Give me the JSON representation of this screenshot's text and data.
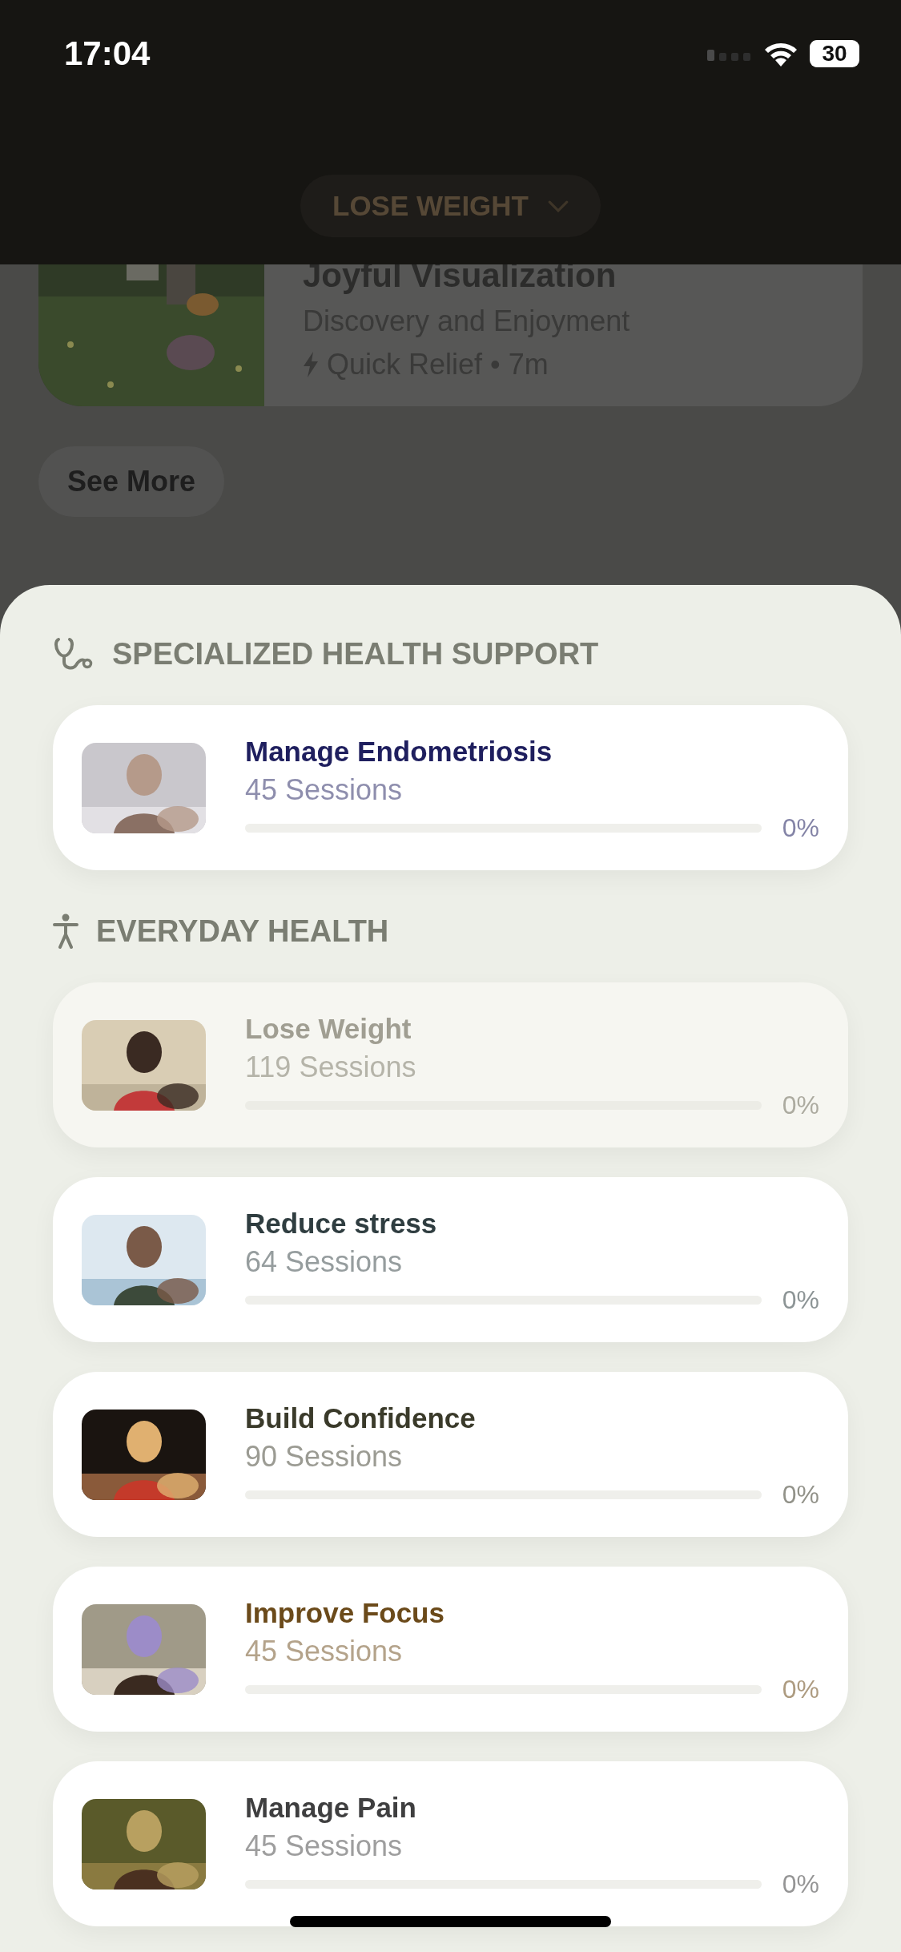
{
  "status_bar": {
    "time": "17:04",
    "battery": "30"
  },
  "header": {
    "goal_button": "LOSE WEIGHT"
  },
  "background": {
    "featured": {
      "title": "Joyful Visualization",
      "subtitle": "Discovery and Enjoyment",
      "meta": "Quick Relief • 7m"
    },
    "see_more": "See More"
  },
  "sections": [
    {
      "title": "SPECIALIZED HEALTH SUPPORT",
      "kind": "stethoscope",
      "programs": [
        {
          "title": "Manage Endometriosis",
          "sessions": "45 Sessions",
          "progress": "0%",
          "level": 0,
          "color": "#1f1f5e",
          "selected": false
        }
      ]
    },
    {
      "title": "EVERYDAY HEALTH",
      "kind": "figure",
      "programs": [
        {
          "title": "Lose Weight",
          "sessions": "119 Sessions",
          "progress": "0%",
          "level": 0,
          "color": "#a09e92",
          "selected": true
        },
        {
          "title": "Reduce stress",
          "sessions": "64 Sessions",
          "progress": "0%",
          "level": 0,
          "color": "#2f3d40",
          "selected": false
        },
        {
          "title": "Build Confidence",
          "sessions": "90 Sessions",
          "progress": "0%",
          "level": 0,
          "color": "#3a3a2a",
          "selected": false
        },
        {
          "title": "Improve Focus",
          "sessions": "45 Sessions",
          "progress": "0%",
          "level": 0,
          "color": "#6b4a1a",
          "selected": false
        },
        {
          "title": "Manage Pain",
          "sessions": "45 Sessions",
          "progress": "0%",
          "level": 0,
          "color": "#3f3f40",
          "selected": false
        }
      ]
    }
  ]
}
